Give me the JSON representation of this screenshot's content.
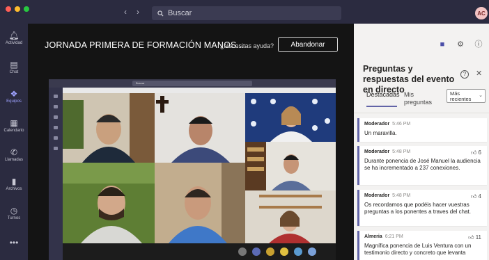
{
  "titlebar": {
    "search_placeholder": "Buscar",
    "avatar_initials": "AC"
  },
  "rail": [
    {
      "label": "Actividad",
      "icon": "bell-icon"
    },
    {
      "label": "Chat",
      "icon": "chat-icon"
    },
    {
      "label": "Equipos",
      "icon": "teams-icon"
    },
    {
      "label": "Calendario",
      "icon": "calendar-icon"
    },
    {
      "label": "Llamadas",
      "icon": "phone-icon"
    },
    {
      "label": "Archivos",
      "icon": "file-icon"
    },
    {
      "label": "Turnos",
      "icon": "clock-icon"
    }
  ],
  "meeting": {
    "title": "JORNADA PRIMERA DE FORMACIÓN MANOS...",
    "help_link": "¿Necesitas ayuda?",
    "leave_button": "Abandonar"
  },
  "shared_screen": {
    "search_placeholder": "Buscar"
  },
  "panel": {
    "title": "Preguntas y respuestas del evento en directo",
    "tabs": [
      "Destacadas",
      "Mis preguntas"
    ],
    "sort": "Más recientes",
    "questions": [
      {
        "author": "Moderador",
        "time": "5:46 PM",
        "likes": "",
        "text": "Un maravilla."
      },
      {
        "author": "Moderador",
        "time": "5:48 PM",
        "likes": "6",
        "text": "Durante ponencia de José Manuel la audiencia se ha incrementado a 237 conexiones."
      },
      {
        "author": "Moderador",
        "time": "5:48 PM",
        "likes": "4",
        "text": "Os recordamos que podéis hacer vuestras preguntas a los ponentes a traves del chat."
      },
      {
        "author": "Almeria",
        "time": "6:21 PM",
        "likes": "11",
        "text": "Magnífica ponencia de Luis Ventura con un testimonio directo y concreto que levanta"
      }
    ]
  },
  "colors": {
    "accent": "#6264a7",
    "rail_bg": "#2b2b40",
    "panel_bg": "#f3f2f1"
  }
}
